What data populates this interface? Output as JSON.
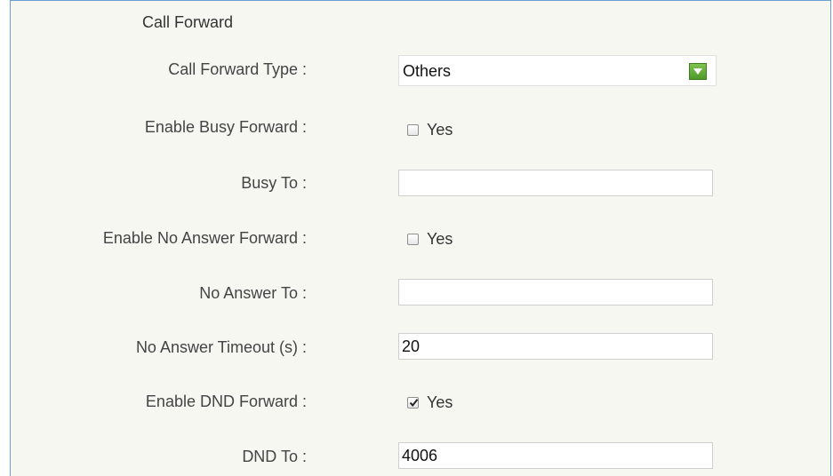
{
  "section": {
    "title": "Call Forward"
  },
  "fields": {
    "forward_type": {
      "label": "Call Forward Type :",
      "value": "Others"
    },
    "busy_enable": {
      "label": "Enable Busy Forward :",
      "option": "Yes",
      "checked": false
    },
    "busy_to": {
      "label": "Busy To :",
      "value": ""
    },
    "noanswer_enable": {
      "label": "Enable No Answer Forward :",
      "option": "Yes",
      "checked": false
    },
    "noanswer_to": {
      "label": "No Answer To :",
      "value": ""
    },
    "noanswer_timeout": {
      "label": "No Answer Timeout (s) :",
      "value": "20"
    },
    "dnd_enable": {
      "label": "Enable DND Forward :",
      "option": "Yes",
      "checked": true
    },
    "dnd_to": {
      "label": "DND To :",
      "value": "4006"
    }
  },
  "icons": {
    "dropdown_arrow": "triangle-down-icon",
    "checkmark": "check-icon"
  },
  "colors": {
    "accent_green": "#5aa832",
    "panel_border": "#6a9fd4",
    "panel_bg": "#f7f7f2"
  }
}
